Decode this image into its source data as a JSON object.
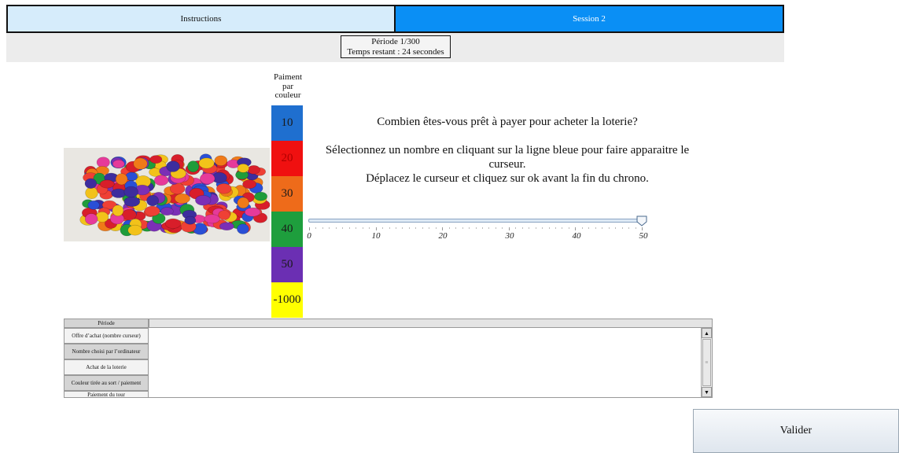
{
  "tabs": {
    "instructions": "Instructions",
    "session": "Session 2"
  },
  "status": {
    "period": "Période 1/300",
    "time_remaining": "Temps restant : 24 secondes"
  },
  "chips_image": {
    "name": "colored-chips-image"
  },
  "payment_column": {
    "header_lines": [
      "Paiment",
      "par",
      "couleur"
    ],
    "cells": [
      {
        "value": "10",
        "color": "#1f6fcf",
        "text_color": "#1a1a1a"
      },
      {
        "value": "20",
        "color": "#f01010",
        "text_color": "#b00000"
      },
      {
        "value": "30",
        "color": "#ee6b1a",
        "text_color": "#1a1a1a"
      },
      {
        "value": "40",
        "color": "#1e9e3d",
        "text_color": "#1a1a1a"
      },
      {
        "value": "50",
        "color": "#6b2fb3",
        "text_color": "#1a1a1a"
      },
      {
        "value": "-1000",
        "color": "#ffff00",
        "text_color": "#1a1a1a"
      }
    ]
  },
  "question": {
    "title": "Combien êtes-vous prêt à payer pour acheter la loterie?",
    "line1": "Sélectionnez un nombre en cliquant sur la ligne bleue pour faire apparaitre le",
    "line2": "curseur.",
    "line3": "Déplacez le curseur et cliquez sur ok avant la fin du chrono."
  },
  "slider": {
    "min": 0,
    "max": 50,
    "value": 50,
    "tick_labels": [
      "0",
      "10",
      "20",
      "30",
      "40",
      "50"
    ]
  },
  "table": {
    "rows": [
      "Période",
      "Offre d’achat (nombre curseur)",
      "Nombre choisi par l’ordinateur",
      "Achat de la loterie",
      "Couleur tirée au sort / paiement",
      "Paiement du tour"
    ]
  },
  "validate_label": "Valider"
}
